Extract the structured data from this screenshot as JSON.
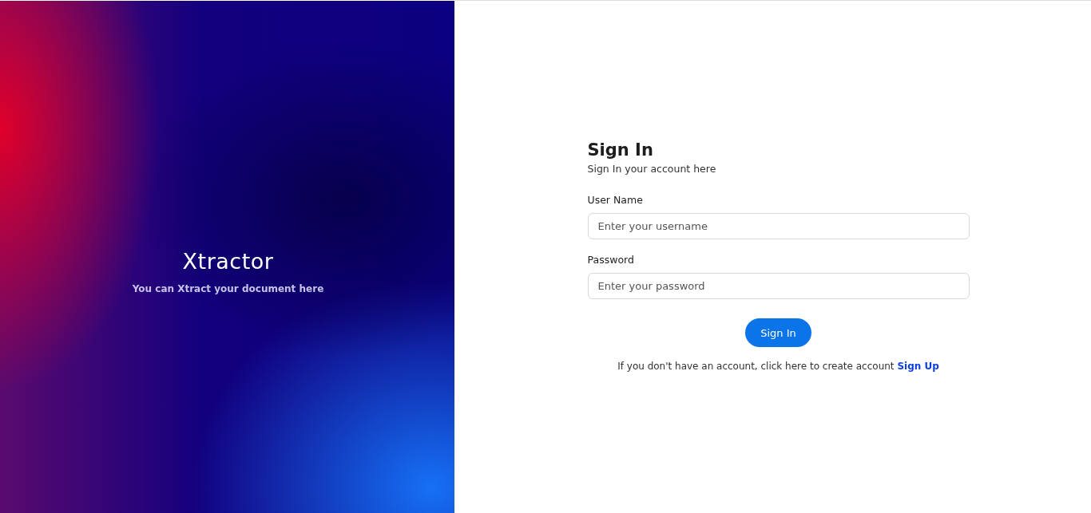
{
  "brand": {
    "logo": "Xtractor",
    "tagline": "You can Xtract your document here"
  },
  "form": {
    "title": "Sign In",
    "subtitle": "Sign In your account here",
    "fields": [
      {
        "label": "User Name",
        "placeholder": "Enter your username"
      },
      {
        "label": "Password",
        "placeholder": "Enter your password"
      }
    ],
    "submit": "Sign In",
    "footer": {
      "text": "If you don't have an account, click here to create account",
      "link": "Sign Up"
    }
  }
}
